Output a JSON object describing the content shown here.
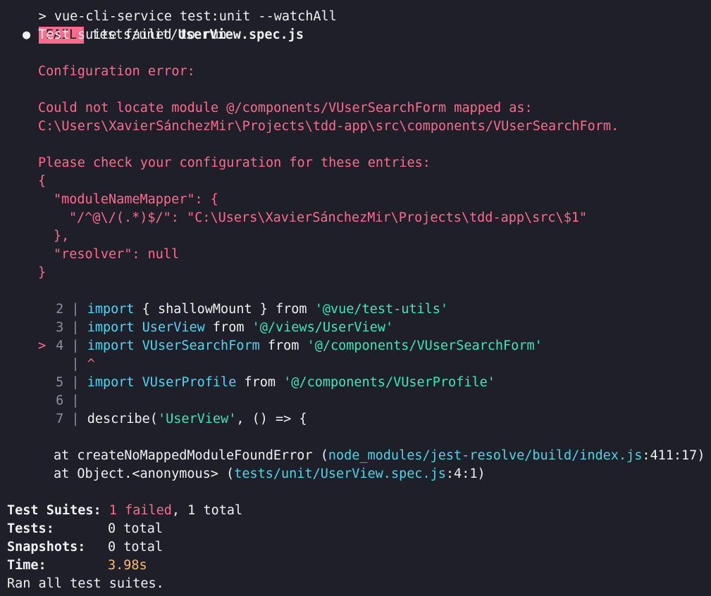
{
  "cmd": "> vue-cli-service test:unit --watchAll",
  "fail_badge": "FAIL",
  "test_file_dir": "tests/unit/",
  "test_file_name": "UserView.spec.js",
  "suite_msg": "Test suite failed to run",
  "bullet": "●",
  "error": {
    "title": "Configuration error:",
    "could_not_locate_1": "Could not locate module @/components/VUserSearchForm mapped as:",
    "could_not_locate_2": "C:\\Users\\XavierSánchezMir\\Projects\\tdd-app\\src\\components/VUserSearchForm.",
    "check": "Please check your configuration for these entries:",
    "brace_open": "{",
    "mapper_key": "\"moduleNameMapper\": {",
    "mapper_entry": "\"/^@\\/(.*)$/\": \"C:\\Users\\XavierSánchezMir\\Projects\\tdd-app\\src\\$1\"",
    "mapper_close": "},",
    "resolver": "\"resolver\": null",
    "brace_close": "}"
  },
  "code": {
    "lines": [
      {
        "marker": " ",
        "num": "2",
        "kw": "import",
        "rest": " { shallowMount } from ",
        "str": "'@vue/test-utils'"
      },
      {
        "marker": " ",
        "num": "3",
        "kw": "import",
        "mid": " ",
        "ident": "UserView",
        "rest": " from ",
        "str": "'@/views/UserView'"
      },
      {
        "marker": ">",
        "num": "4",
        "kw": "import",
        "mid": " ",
        "ident": "VUserSearchForm",
        "rest": " from ",
        "str": "'@/components/VUserSearchForm'"
      },
      {
        "marker": " ",
        "num": "5",
        "kw": "import",
        "mid": " ",
        "ident": "VUserProfile",
        "rest": " from ",
        "str": "'@/components/VUserProfile'"
      },
      {
        "marker": " ",
        "num": "6"
      },
      {
        "marker": " ",
        "num": "7",
        "pre": "describe(",
        "str": "'UserView'",
        "post": ", () => {"
      }
    ],
    "pipe": "|",
    "caret": "^"
  },
  "stack": [
    {
      "prefix": "at createNoMappedModuleFoundError (",
      "path": "node_modules/jest-resolve/build/index.js",
      "loc": ":411:17",
      "suffix": ")"
    },
    {
      "prefix": "at Object.<anonymous> (",
      "path": "tests/unit/UserView.spec.js",
      "loc": ":4:1",
      "suffix": ")"
    }
  ],
  "summary": {
    "suites_label": "Test Suites:",
    "suites_failed": "1 failed",
    "suites_total": ", 1 total",
    "tests_label": "Tests:",
    "tests_value": "0 total",
    "snapshots_label": "Snapshots:",
    "snapshots_value": "0 total",
    "time_label": "Time:",
    "time_value": "3.98s",
    "ran_all": "Ran all test suites."
  },
  "colors": {
    "background": "#1e1f29",
    "error_red": "#ff6b8d",
    "string_green": "#3ee6b8",
    "path_cyan": "#4fd4e8",
    "time_orange": "#ffb86c"
  }
}
